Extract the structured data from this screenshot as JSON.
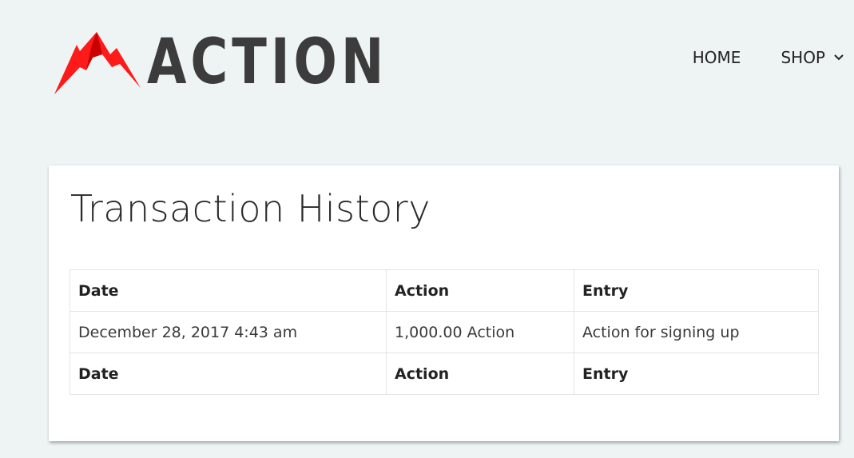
{
  "brand": {
    "name": "ACTION",
    "logo_color": "#ff1a1a",
    "text_color": "#3c3c3c"
  },
  "nav": {
    "items": [
      {
        "label": "HOME"
      },
      {
        "label": "SHOP",
        "icon": "chevron-down-icon"
      }
    ]
  },
  "page": {
    "title": "Transaction History"
  },
  "table": {
    "headers": [
      "Date",
      "Action",
      "Entry"
    ],
    "rows": [
      [
        "December 28, 2017 4:43 am",
        "1,000.00 Action",
        "Action for signing up"
      ]
    ],
    "footers": [
      "Date",
      "Action",
      "Entry"
    ]
  }
}
